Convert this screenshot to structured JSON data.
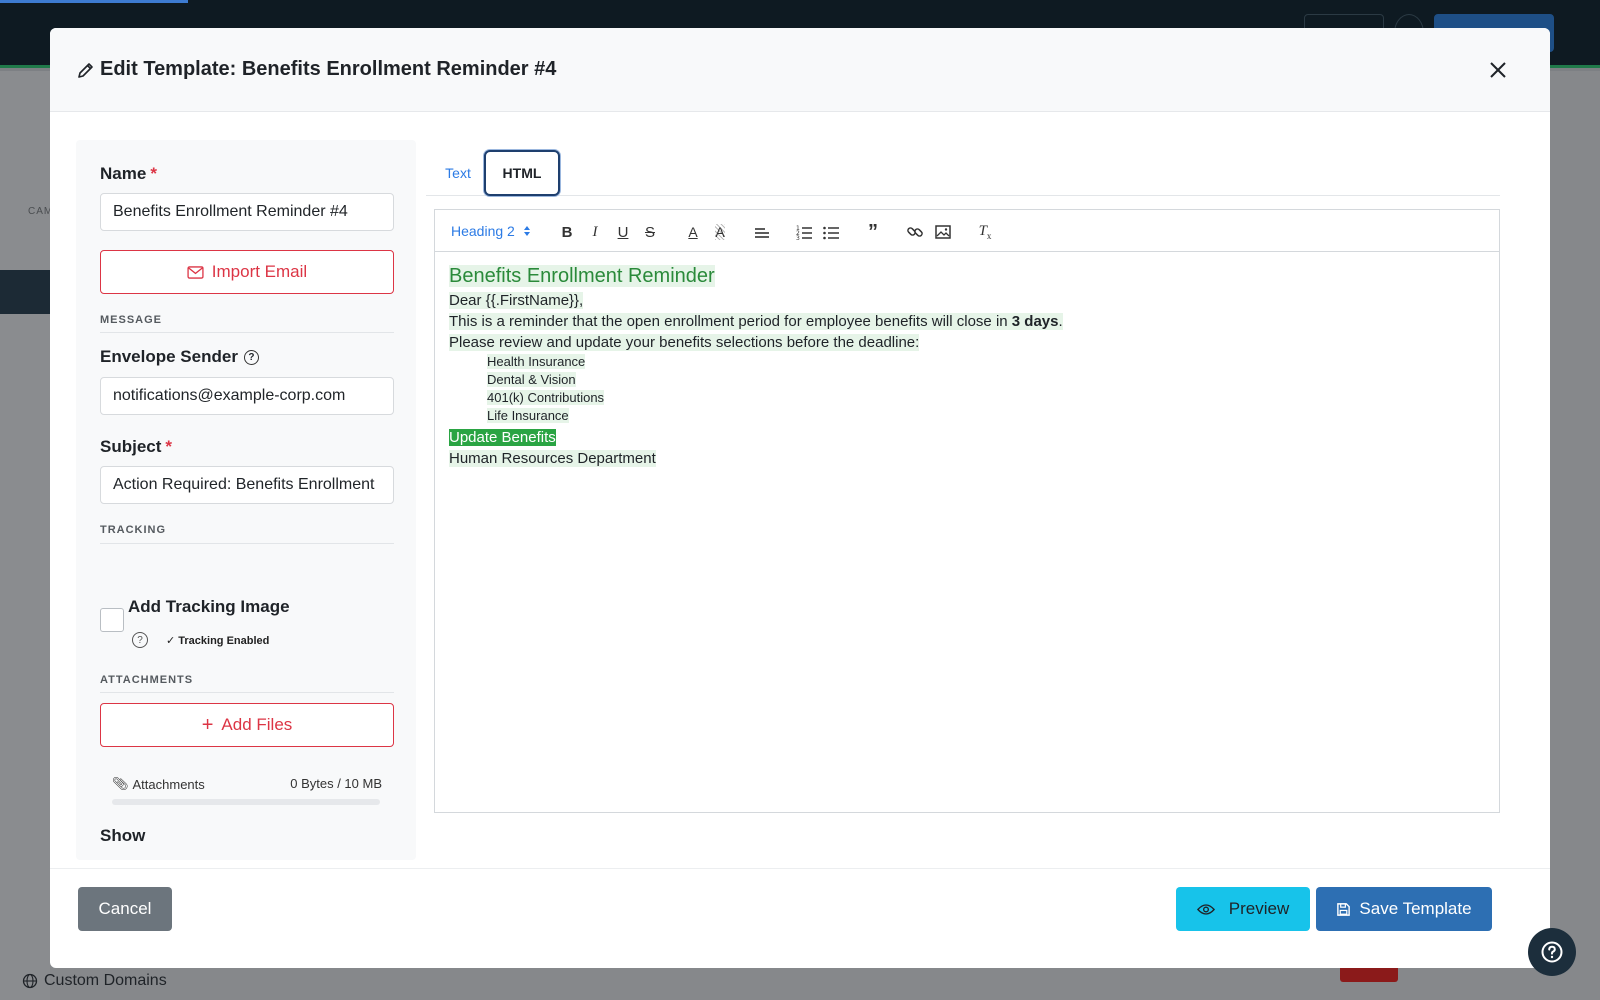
{
  "modal": {
    "title": "Edit Template: Benefits Enrollment Reminder #4",
    "close_icon": "close-icon"
  },
  "form": {
    "name_label": "Name",
    "required_mark": "*",
    "name_value": "Benefits Enrollment Reminder #4",
    "import_label": "Import Email",
    "message_caption": "MESSAGE",
    "envelope_label": "Envelope Sender",
    "envelope_value": "notifications@example-corp.com",
    "subject_label": "Subject",
    "subject_value": "Action Required: Benefits Enrollment",
    "tracking_caption": "TRACKING",
    "tracking_checkbox_label": "Add Tracking Image",
    "tracking_note": "✓ Tracking Enabled",
    "attachments_caption": "ATTACHMENTS",
    "add_files_label": "Add Files",
    "attachments_label": "Attachments",
    "attachments_size": "0 Bytes / 10 MB",
    "show_label": "Show"
  },
  "tabs": [
    {
      "label": "Text",
      "active": false
    },
    {
      "label": "HTML",
      "active": true
    }
  ],
  "toolbar": {
    "heading_select": "Heading 2"
  },
  "editor": {
    "heading": "Benefits Enrollment Reminder",
    "greeting": "Dear {{.FirstName}},",
    "line1_prefix": "This is a reminder that the open enrollment period for employee benefits will close in ",
    "line1_bold": "3 days",
    "line1_suffix": ".",
    "line2": "Please review and update your benefits selections before the deadline:",
    "list": [
      "Health Insurance",
      "Dental & Vision",
      "401(k) Contributions",
      "Life Insurance"
    ],
    "cta": "Update Benefits",
    "signature": "Human Resources Department"
  },
  "footer": {
    "cancel": "Cancel",
    "preview": "Preview",
    "save": "Save Template"
  },
  "background": {
    "sidebar_caption": "CAM",
    "bottom_item": "Custom Domains"
  },
  "colors": {
    "danger": "#dc3545",
    "primary": "#2d6fb3",
    "info": "#17c3ea",
    "secondary": "#6c757d",
    "heading_green": "#2a8a3a"
  }
}
